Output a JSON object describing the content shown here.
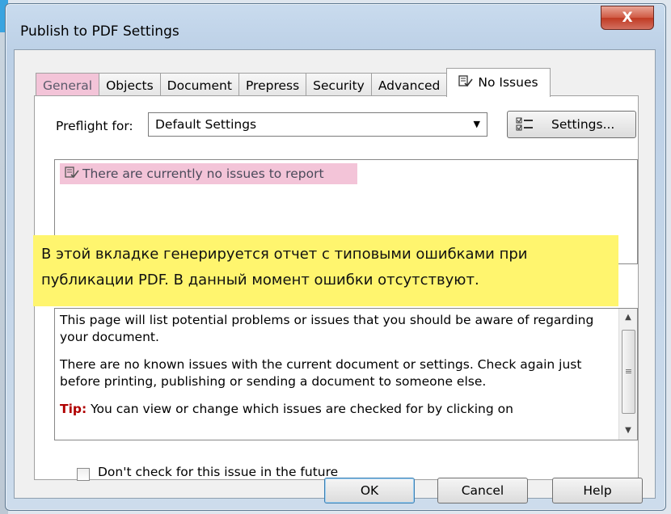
{
  "window": {
    "title": "Publish to PDF Settings",
    "close_label": "X"
  },
  "tabs": [
    {
      "label": "General",
      "state": "highlighted"
    },
    {
      "label": "Objects"
    },
    {
      "label": "Document"
    },
    {
      "label": "Prepress"
    },
    {
      "label": "Security"
    },
    {
      "label": "Advanced"
    },
    {
      "label": "No Issues",
      "state": "active",
      "icon": "preflight-icon"
    }
  ],
  "preflight": {
    "label": "Preflight for:",
    "selected": "Default Settings",
    "settings_label": "Settings...",
    "settings_icon": "checklist-icon"
  },
  "issues": {
    "message": "There are currently no issues to report"
  },
  "note": "В этой вкладке генерируется отчет с типовыми ошибками при публикации PDF. В данный момент ошибки отсутствуют.",
  "description": {
    "p1": "This page will list potential problems or issues that you should be aware of regarding your document.",
    "p2": "There are no known issues with the current document or settings. Check again just before printing, publishing or sending a document to someone else.",
    "tip_label": "Tip:",
    "tip_text": " You can view or change which issues are checked for by clicking on"
  },
  "checkbox": {
    "label": "Don't check for this issue in the future",
    "checked": false
  },
  "buttons": {
    "ok": "OK",
    "cancel": "Cancel",
    "help": "Help"
  },
  "colors": {
    "highlight_pink": "#f3c4d8",
    "note_yellow": "#fff56e",
    "tip_red": "#b00000"
  }
}
